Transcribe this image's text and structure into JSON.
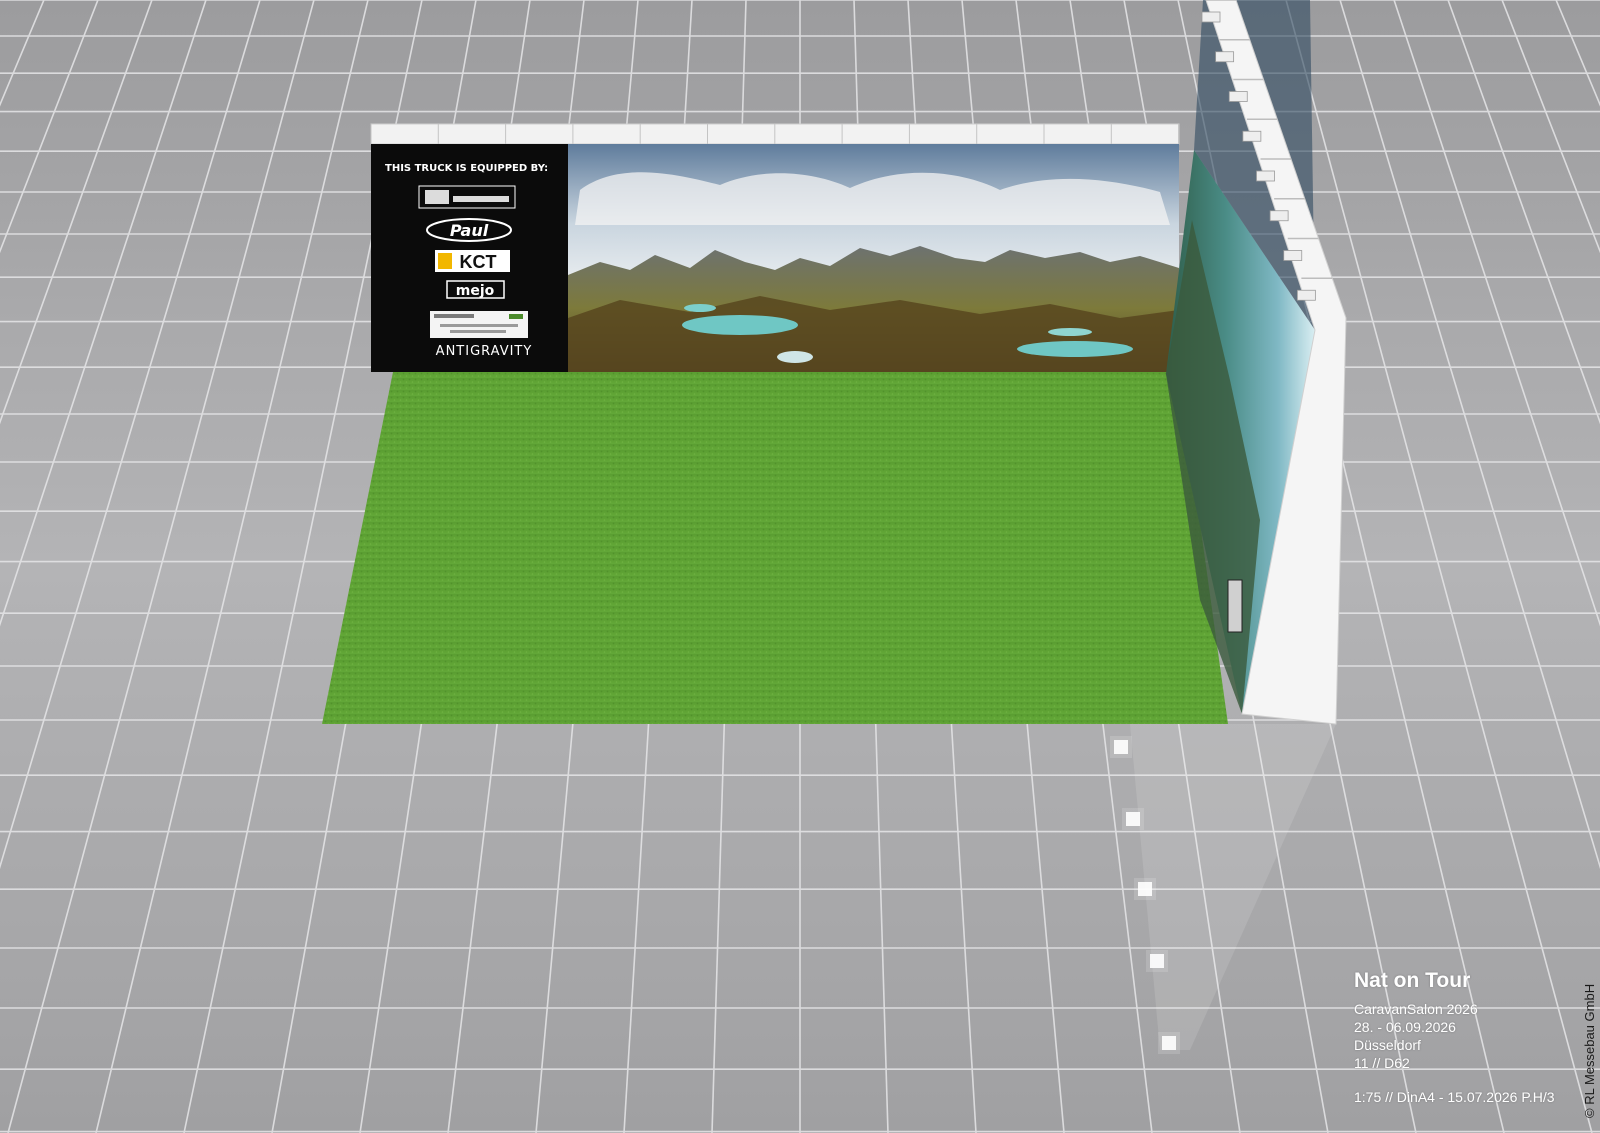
{
  "sponsor_panel": {
    "heading": "THIS TRUCK IS EQUIPPED BY:",
    "logos": [
      {
        "name": "truck-parts-logo",
        "text": ""
      },
      {
        "name": "paul-logo",
        "text": "Paul"
      },
      {
        "name": "kct-logo",
        "text": "KCT"
      },
      {
        "name": "mejo-logo",
        "text": "mejo"
      },
      {
        "name": "partner-badge",
        "text": ""
      },
      {
        "name": "antigravity-logo",
        "text": "ANTIGRAVITY"
      }
    ]
  },
  "caption": {
    "title": "Nat on Tour",
    "event": "CaravanSalon 2026",
    "dates": "28. - 06.09.2026",
    "city": "Düsseldorf",
    "hall_stand": "11 // D62",
    "scale_line": "1:75 // DinA4 - 15.07.2026 P.H/3"
  },
  "copyright": "© RL Messebau GmbH",
  "colors": {
    "floor": "#a6a6a8",
    "grid_line": "#e6e6e8",
    "grass": "#5da134",
    "panel_black": "#0b0b0b",
    "frame": "#f2f2f2"
  }
}
